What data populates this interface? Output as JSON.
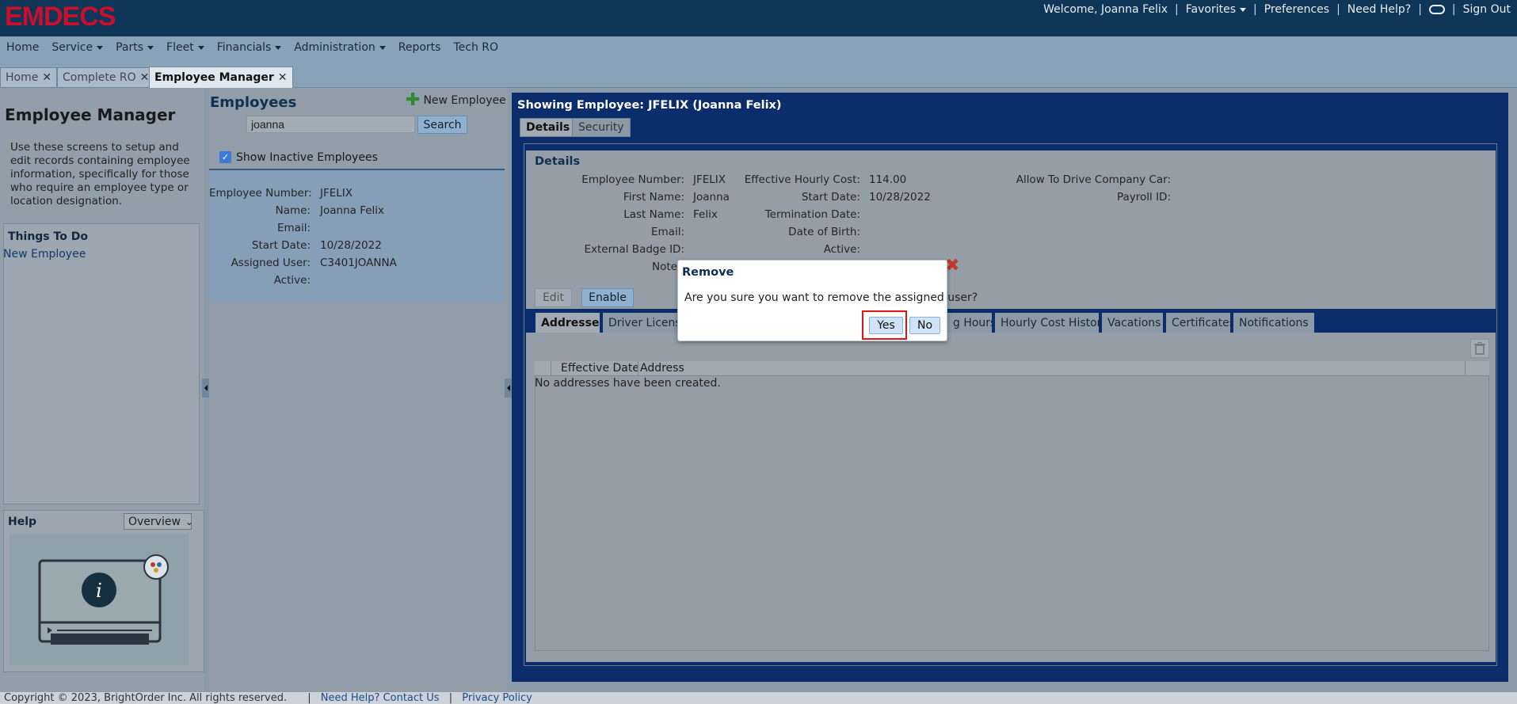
{
  "app": {
    "logo": "EMDECS"
  },
  "topbar": {
    "welcome": "Welcome, Joanna Felix",
    "favorites": "Favorites",
    "preferences": "Preferences",
    "need_help": "Need Help?",
    "sign_out": "Sign Out",
    "seps": [
      "|",
      "|",
      "|",
      "|",
      "|"
    ]
  },
  "menu": {
    "items": [
      "Home",
      "Service",
      "Parts",
      "Fleet",
      "Financials",
      "Administration",
      "Reports",
      "Tech RO"
    ]
  },
  "page_tabs": [
    {
      "label": "Home"
    },
    {
      "label": "Complete RO"
    },
    {
      "label": "Employee Manager"
    }
  ],
  "left": {
    "title": "Employee Manager",
    "description": "Use these screens to setup and edit records containing employee information, specifically for those who require an employee type or location designation.",
    "todo_title": "Things To Do",
    "todo_link": "New Employee",
    "help_title": "Help",
    "help_select": "Overview"
  },
  "employees": {
    "title": "Employees",
    "new_label": "New Employee",
    "search_value": "joanna",
    "search_button": "Search",
    "show_inactive": "Show Inactive Employees",
    "show_inactive_checked": true,
    "card": [
      {
        "label": "Employee Number:",
        "value": "JFELIX"
      },
      {
        "label": "Name:",
        "value": "Joanna Felix"
      },
      {
        "label": "Email:",
        "value": ""
      },
      {
        "label": "Start Date:",
        "value": "10/28/2022"
      },
      {
        "label": "Assigned User:",
        "value": "C3401JOANNA"
      },
      {
        "label": "Active:",
        "value": ""
      }
    ]
  },
  "detail": {
    "title": "Showing Employee: JFELIX (Joanna Felix)",
    "tabs": [
      "Details",
      "Security"
    ],
    "section_title": "Details",
    "col1": [
      {
        "label": "Employee Number:",
        "value": "JFELIX"
      },
      {
        "label": "First Name:",
        "value": "Joanna"
      },
      {
        "label": "Last Name:",
        "value": "Felix"
      },
      {
        "label": "Email:",
        "value": ""
      },
      {
        "label": "External Badge ID:",
        "value": ""
      },
      {
        "label": "Note",
        "value": ""
      }
    ],
    "col2": [
      {
        "label": "Effective Hourly Cost:",
        "value": "114.00"
      },
      {
        "label": "Start Date:",
        "value": "10/28/2022"
      },
      {
        "label": "Termination Date:",
        "value": ""
      },
      {
        "label": "Date of Birth:",
        "value": ""
      },
      {
        "label": "Active:",
        "value": ""
      }
    ],
    "col3": [
      {
        "label": "Allow To Drive Company Car:",
        "value": ""
      },
      {
        "label": "Payroll ID:",
        "value": ""
      }
    ],
    "edit_label": "Edit",
    "enable_label": "Enable",
    "subtabs": [
      "Addresses",
      "Driver License",
      "g Hours",
      "Hourly Cost History",
      "Vacations",
      "Certificates",
      "Notifications"
    ],
    "grid_headers": [
      "",
      "Effective Date",
      "Address"
    ],
    "empty_message": "No addresses have been created."
  },
  "modal": {
    "title": "Remove",
    "message": "Are you sure you want to remove the assigned user?",
    "yes": "Yes",
    "no": "No"
  },
  "footer": {
    "copyright": "Copyright © 2023, BrightOrder Inc. All rights reserved.",
    "contact": "Need Help? Contact Us",
    "privacy": "Privacy Policy",
    "seps": [
      "|",
      "|"
    ]
  },
  "colors": {
    "brand": "#c8102e",
    "header": "#0f3557",
    "panel_blue": "#0b2d6b",
    "highlight": "#e01414",
    "remove_icon": "#c0392b",
    "add_icon": "#2e8b2e"
  }
}
